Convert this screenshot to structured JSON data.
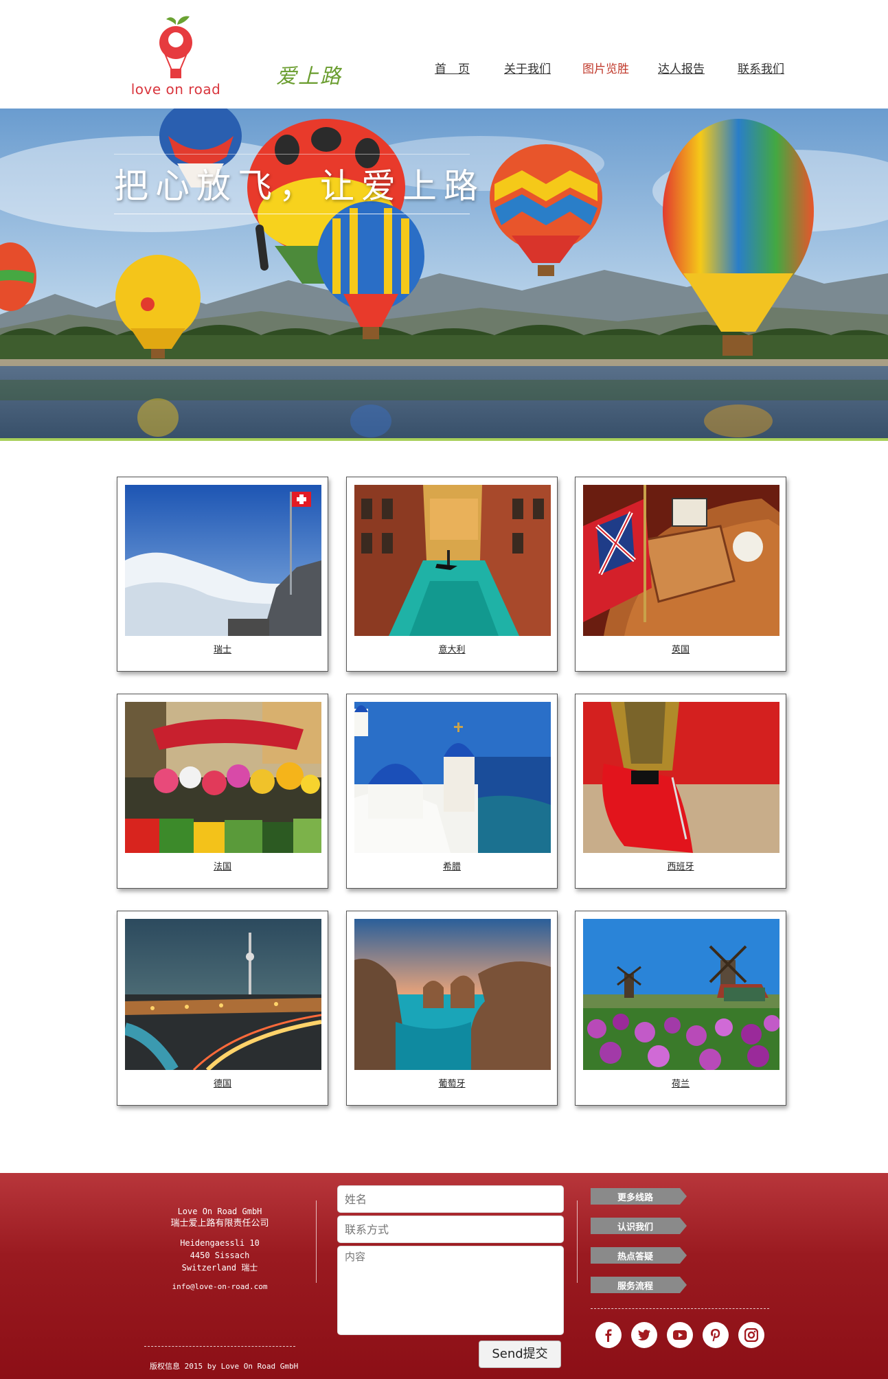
{
  "header": {
    "logo_text": "love on road",
    "brand_cn": "爱上路",
    "nav": [
      {
        "label": "首　页",
        "active": false
      },
      {
        "label": "关于我们",
        "active": false
      },
      {
        "label": "图片览胜",
        "active": true
      },
      {
        "label": "达人报告",
        "active": false
      },
      {
        "label": "联系我们",
        "active": false
      }
    ]
  },
  "hero": {
    "title": "把心放飞，让爱上路"
  },
  "gallery": [
    {
      "caption": "瑞士",
      "icon": "switzerland-mountain-photo"
    },
    {
      "caption": "意大利",
      "icon": "venice-canal-photo"
    },
    {
      "caption": "英国",
      "icon": "boat-union-jack-photo"
    },
    {
      "caption": "法国",
      "icon": "flower-market-photo"
    },
    {
      "caption": "希腊",
      "icon": "santorini-church-photo"
    },
    {
      "caption": "西班牙",
      "icon": "matador-cape-photo"
    },
    {
      "caption": "德国",
      "icon": "berlin-night-photo"
    },
    {
      "caption": "葡萄牙",
      "icon": "algarve-coast-photo"
    },
    {
      "caption": "荷兰",
      "icon": "windmill-tulips-photo"
    }
  ],
  "footer": {
    "company_en": "Love On Road GmbH",
    "company_cn": "瑞士爱上路有限责任公司",
    "address_line1": "Heidengaessli 10",
    "address_line2": "4450 Sissach",
    "address_line3": "Switzerland 瑞士",
    "email": "info@love-on-road.com",
    "copyright": "版权信息 2015 by Love On Road GmbH",
    "form": {
      "name_placeholder": "姓名",
      "contact_placeholder": "联系方式",
      "message_placeholder": "内容",
      "send_label": "Send提交"
    },
    "links": [
      "更多线路",
      "认识我们",
      "热点答疑",
      "服务流程"
    ],
    "social": [
      "facebook-icon",
      "twitter-icon",
      "youtube-icon",
      "pinterest-icon",
      "instagram-icon"
    ]
  },
  "colors": {
    "accent_red": "#c0392b",
    "footer_red": "#9a1a20",
    "brand_green": "#6a9d2f",
    "hero_line": "#a8cf5a"
  }
}
